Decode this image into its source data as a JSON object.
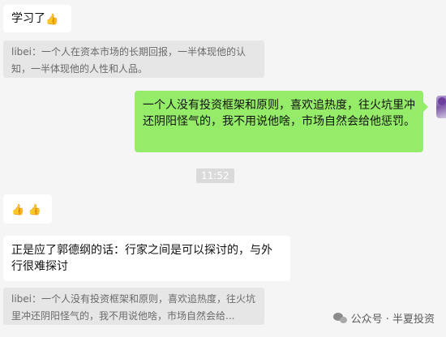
{
  "messages": {
    "m1": {
      "text": "学习了",
      "emoji": "👍"
    },
    "q1": {
      "text": "libei：一个人在资本市场的长期回报，一半体现他的认知，一半体现他的人性和人品。"
    },
    "m2": {
      "text": "一个人没有投资框架和原则，喜欢追热度，往火坑里冲还阴阳怪气的，我不用说他啥，市场自然会给他惩罚。"
    },
    "time": "11:52",
    "m3": {
      "emoji_1": "👍",
      "emoji_2": "👍"
    },
    "m4": {
      "text": "正是应了郭德纲的话：行家之间是可以探讨的，与外行很难探讨"
    },
    "q2": {
      "text": "libei：一个人没有投资框架和原则，喜欢追热度，往火坑里冲还阴阳怪气的，我不用说他啥，市场自然会给..."
    }
  },
  "watermark": {
    "text": "公众号 · 半夏投资",
    "icon": "wechat-icon"
  },
  "colors": {
    "background": "#f5f5f5",
    "self_bubble": "#95ec69",
    "other_bubble": "#ffffff",
    "quote": "#e6e6e6"
  }
}
